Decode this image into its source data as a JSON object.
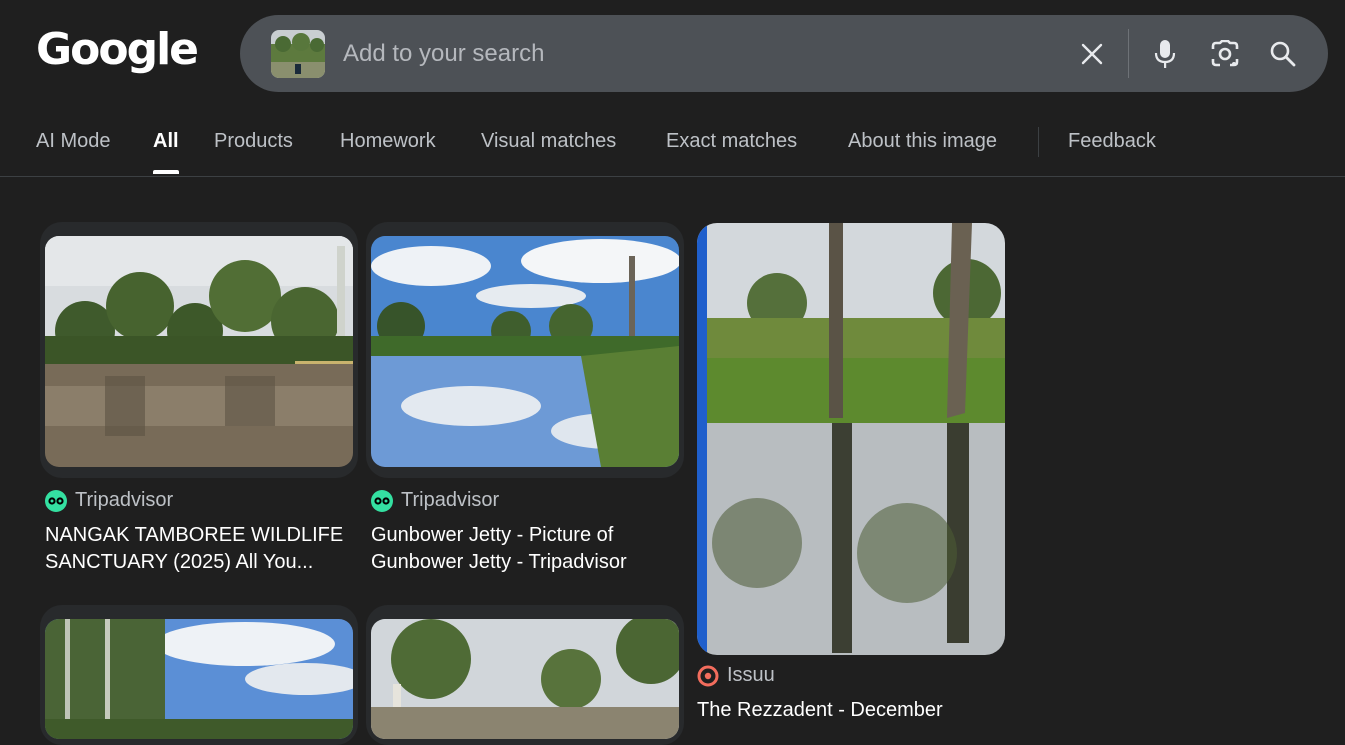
{
  "header": {
    "logo_text": "Google",
    "search": {
      "placeholder": "Add to your search",
      "value": ""
    },
    "icons": [
      "close-icon",
      "microphone-icon",
      "lens-icon",
      "search-icon"
    ]
  },
  "tabs": [
    {
      "label": "AI Mode",
      "active": false
    },
    {
      "label": "All",
      "active": true
    },
    {
      "label": "Products",
      "active": false
    },
    {
      "label": "Homework",
      "active": false
    },
    {
      "label": "Visual matches",
      "active": false
    },
    {
      "label": "Exact matches",
      "active": false
    },
    {
      "label": "About this image",
      "active": false
    },
    {
      "label": "Feedback",
      "active": false
    }
  ],
  "results": [
    {
      "source": "Tripadvisor",
      "title": "NANGAK TAMBOREE WILDLIFE SANCTUARY (2025) All You...",
      "favicon": "tripadvisor-icon"
    },
    {
      "source": "Tripadvisor",
      "title": "Gunbower Jetty - Picture of Gunbower Jetty - Tripadvisor",
      "favicon": "tripadvisor-icon"
    },
    {
      "source": "Issuu",
      "title": "The Rezzadent - December",
      "favicon": "issuu-icon"
    },
    {
      "source": "",
      "title": ""
    },
    {
      "source": "",
      "title": ""
    }
  ],
  "colors": {
    "background": "#1f1f1f",
    "search_bar": "#4d5156",
    "tripadvisor_green": "#34e0a1",
    "issuu_red": "#f36d5d"
  }
}
